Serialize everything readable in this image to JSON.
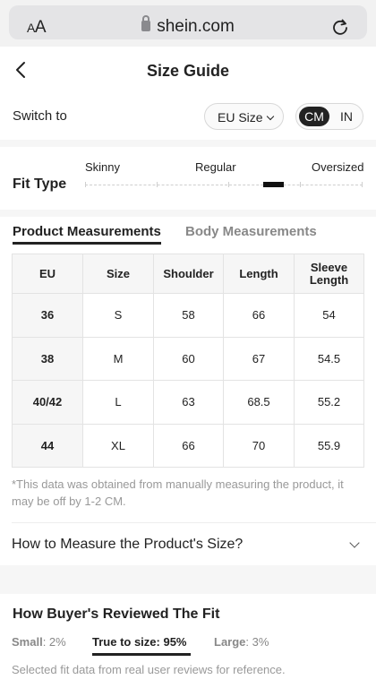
{
  "browser": {
    "text_size_label_small": "A",
    "text_size_label_large": "A",
    "url": "shein.com",
    "reload_icon": "reload-icon",
    "lock_icon": "lock-icon"
  },
  "header": {
    "title": "Size Guide",
    "back_icon": "chevron-left-icon"
  },
  "switch": {
    "label": "Switch to",
    "size_system": "EU Size",
    "unit_selected": "CM",
    "unit_other": "IN"
  },
  "fit": {
    "label": "Fit Type",
    "options": [
      "Skinny",
      "Regular",
      "Oversized"
    ],
    "selected_level": 0.68
  },
  "tabs": {
    "active": "Product Measurements",
    "inactive": "Body Measurements"
  },
  "table": {
    "headers": [
      "EU",
      "Size",
      "Shoulder",
      "Length",
      "Sleeve Length"
    ],
    "rows": [
      [
        "36",
        "S",
        "58",
        "66",
        "54"
      ],
      [
        "38",
        "M",
        "60",
        "67",
        "54.5"
      ],
      [
        "40/42",
        "L",
        "63",
        "68.5",
        "55.2"
      ],
      [
        "44",
        "XL",
        "66",
        "70",
        "55.9"
      ]
    ]
  },
  "note": "*This data was obtained from manually measuring the product, it may be off by 1-2 CM.",
  "how_to": {
    "label": "How to Measure the Product's Size?"
  },
  "reviews": {
    "title": "How Buyer's Reviewed The Fit",
    "small_label": "Small",
    "small_value": ": 2%",
    "true_label": "True to size: 95%",
    "large_label": "Large",
    "large_value": ": 3%",
    "footnote": "Selected fit data from real user reviews for reference."
  },
  "colors": {
    "accent": "#222222",
    "muted": "#888888"
  }
}
